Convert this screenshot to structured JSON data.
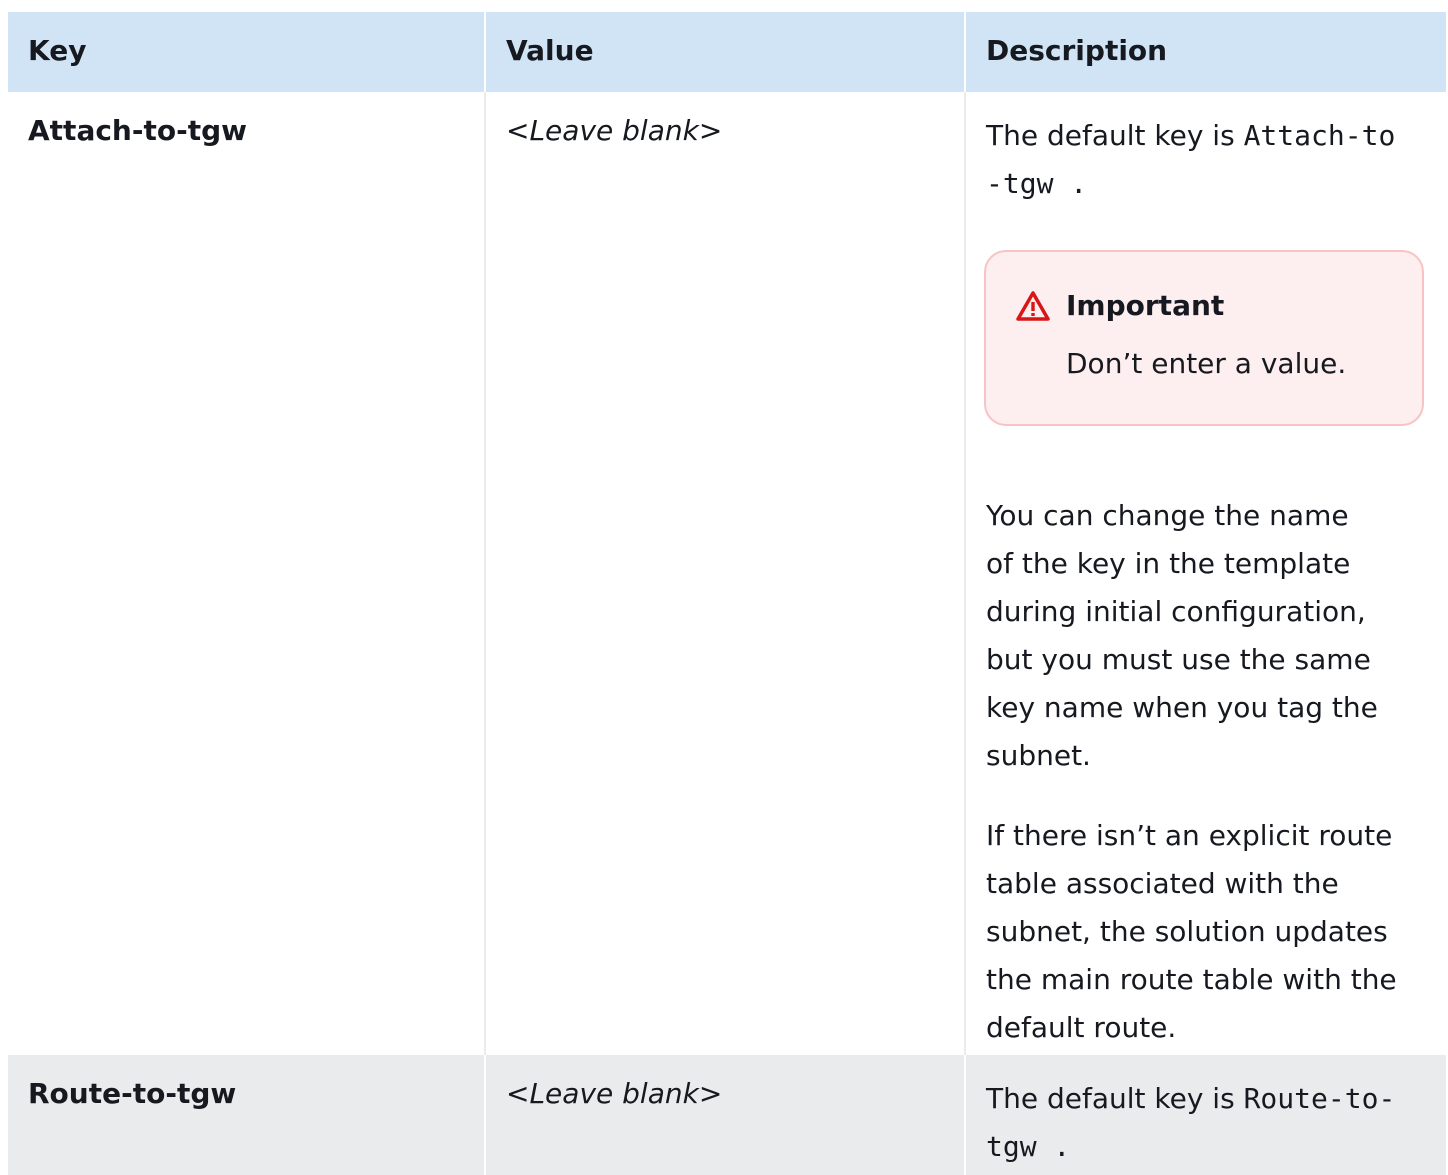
{
  "table": {
    "headers": [
      "Key",
      "Value",
      "Description"
    ],
    "rows": [
      {
        "key": "Attach-to-tgw",
        "value": "<Leave blank>",
        "description": {
          "default_prefix": "The default key is ",
          "default_code_part1": "Attach-to",
          "default_code_part2": "-tgw",
          "default_suffix": " .",
          "callout": {
            "icon": "warning-triangle-icon",
            "title": "Important",
            "body": "Don’t enter a value."
          },
          "para2_lines": [
            "You can change the name",
            "of the key in the template",
            "during initial configuration,",
            "but you must use the same",
            "key name when you tag the",
            "subnet."
          ],
          "para3_lines": [
            "If there isn’t an explicit route",
            "table associated with the",
            "subnet, the solution updates",
            "the main route table with the",
            "default route."
          ]
        }
      },
      {
        "key": "Route-to-tgw",
        "value": "<Leave blank>",
        "description": {
          "default_prefix": "The default key is ",
          "default_code_part1": "Route-to-",
          "default_code_part2": "tgw",
          "default_suffix": " ."
        }
      }
    ]
  },
  "colors": {
    "header_bg": "#d1e4f5",
    "alt_row_bg": "#e9ebed",
    "callout_bg": "#fdeeef",
    "callout_border": "#f7c3c5",
    "warning_red": "#d91515"
  }
}
